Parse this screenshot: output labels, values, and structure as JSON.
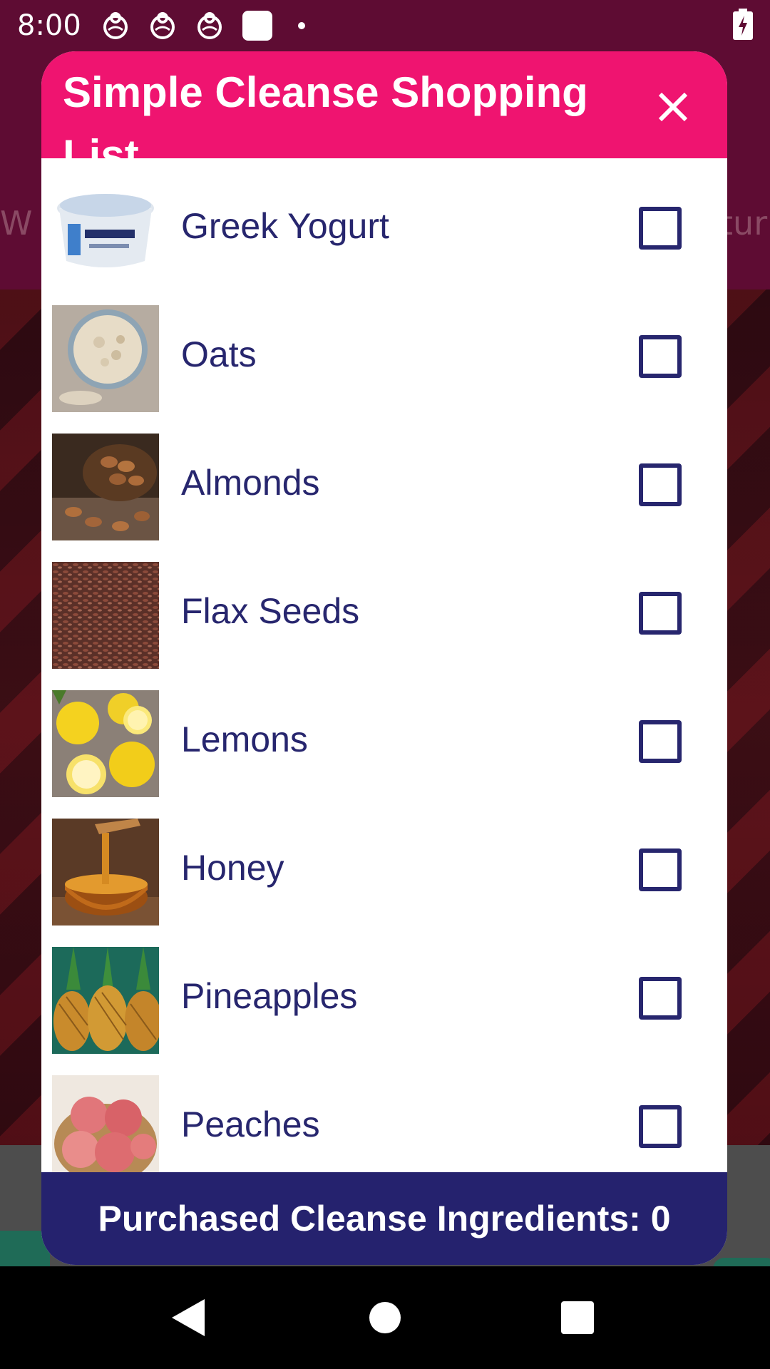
{
  "status_bar": {
    "time": "8:00",
    "icons": [
      "notification-icon",
      "notification-icon",
      "notification-icon",
      "square-icon",
      "dot-icon",
      "battery-charging-icon"
    ]
  },
  "background": {
    "partial_left": "W",
    "partial_right": "tur"
  },
  "dialog": {
    "title": "Simple Cleanse Shopping List",
    "close_icon": "close-icon",
    "items": [
      {
        "label": "Greek Yogurt",
        "checked": false
      },
      {
        "label": "Oats",
        "checked": false
      },
      {
        "label": "Almonds",
        "checked": false
      },
      {
        "label": "Flax Seeds",
        "checked": false
      },
      {
        "label": "Lemons",
        "checked": false
      },
      {
        "label": "Honey",
        "checked": false
      },
      {
        "label": "Pineapples",
        "checked": false
      },
      {
        "label": "Peaches",
        "checked": false
      }
    ],
    "footer": "Purchased Cleanse Ingredients: 0"
  },
  "colors": {
    "header": "#ef1470",
    "footer": "#25226e",
    "text": "#27266e",
    "app_bar": "#5e0c33"
  },
  "nav_bar": {
    "icons": [
      "back-icon",
      "home-icon",
      "recents-icon"
    ]
  }
}
